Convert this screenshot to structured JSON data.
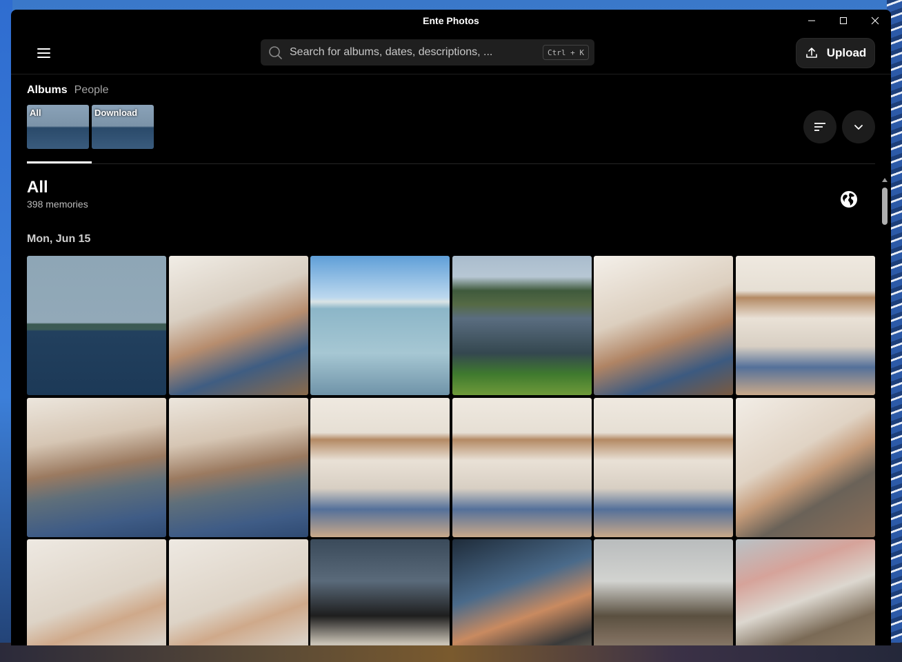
{
  "window": {
    "title": "Ente Photos"
  },
  "search": {
    "placeholder": "Search for albums, dates, descriptions, ...",
    "shortcut": "Ctrl + K"
  },
  "upload": {
    "label": "Upload"
  },
  "tabs": [
    {
      "label": "Albums",
      "active": true
    },
    {
      "label": "People",
      "active": false
    }
  ],
  "albums": [
    {
      "label": "All"
    },
    {
      "label": "Download"
    }
  ],
  "gallery": {
    "title": "All",
    "count": "398 memories",
    "date_header": "Mon, Jun 15"
  },
  "photos": [
    {
      "type": "lake-boat"
    },
    {
      "type": "family-a"
    },
    {
      "type": "lake-pier"
    },
    {
      "type": "lake-calm"
    },
    {
      "type": "family-b"
    },
    {
      "type": "kitchen"
    },
    {
      "type": "family-c"
    },
    {
      "type": "family-c"
    },
    {
      "type": "kitchen"
    },
    {
      "type": "kitchen"
    },
    {
      "type": "kitchen"
    },
    {
      "type": "family-d"
    },
    {
      "type": "family-e"
    },
    {
      "type": "family-e"
    },
    {
      "type": "gaming-a"
    },
    {
      "type": "gaming-b"
    },
    {
      "type": "studio-a"
    },
    {
      "type": "studio-b"
    }
  ],
  "icons": {
    "menu": "hamburger-menu-icon",
    "search": "search-icon",
    "upload": "upload-icon",
    "sort": "sort-icon",
    "expand": "chevron-down-icon",
    "map": "globe-icon",
    "minimize": "minimize-icon",
    "maximize": "maximize-icon",
    "close": "close-icon"
  }
}
